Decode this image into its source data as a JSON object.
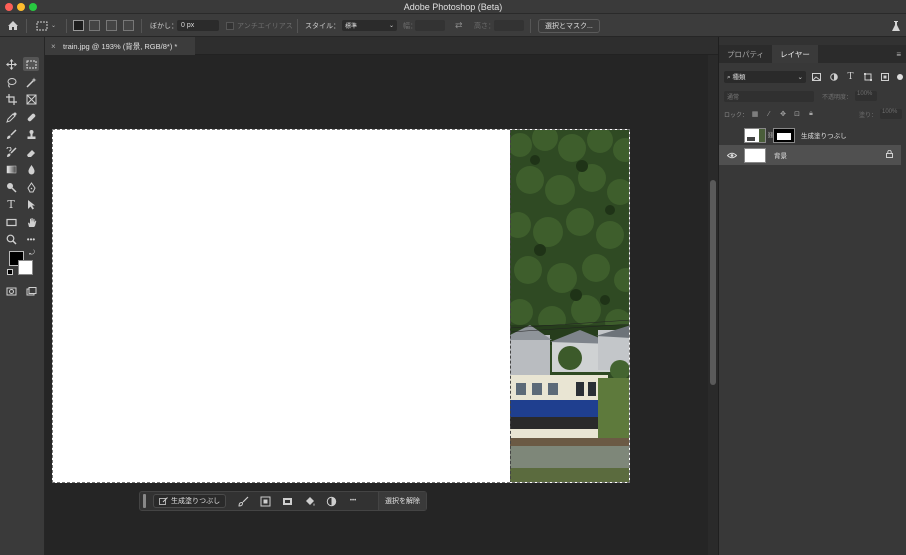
{
  "app": {
    "title": "Adobe Photoshop (Beta)"
  },
  "options_bar": {
    "feather_label": "ぼかし：",
    "feather_value": "0 px",
    "antialias_label": "アンチエイリアス",
    "style_label": "スタイル：",
    "style_value": "標準",
    "width_label": "幅：",
    "height_label": "高さ：",
    "select_mask_button": "選択とマスク..."
  },
  "document": {
    "tab_title": "train.jpg @ 193% (背景, RGB/8*) *"
  },
  "contextual_taskbar": {
    "generative_fill": "生成塗りつぶし",
    "more": "•••",
    "deselect": "選択を解除"
  },
  "panels": {
    "tabs": [
      {
        "label": "プロパティ",
        "active": false
      },
      {
        "label": "レイヤー",
        "active": true
      }
    ],
    "filter_select": "種類",
    "blend_mode": "通常",
    "opacity_label": "不透明度：",
    "opacity_value": "100%",
    "lock_label": "ロック：",
    "fill_label": "塗り：",
    "fill_value": "100%",
    "layers": [
      {
        "name": "生成塗りつぶし",
        "visible": false,
        "selected": false,
        "has_mask": true
      },
      {
        "name": "背景",
        "visible": true,
        "selected": true,
        "locked": true
      }
    ]
  },
  "colors": {
    "foreground": "#000000",
    "background": "#ffffff"
  }
}
